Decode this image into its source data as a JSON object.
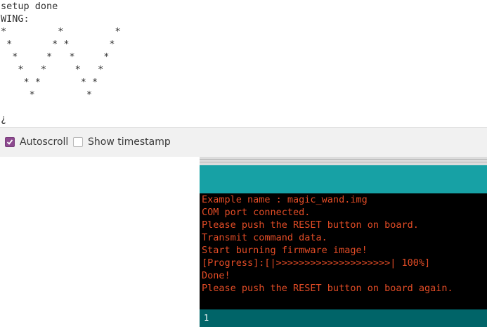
{
  "serial_monitor": {
    "lines": [
      "setup done",
      "WING:",
      "*         *         *",
      " *       * *       *",
      "  *     *   *     *",
      "   *   *     *   *",
      "    * *       * *",
      "     *         *",
      "",
      "¿"
    ],
    "autoscroll_label": "Autoscroll",
    "autoscroll_checked": true,
    "timestamp_label": "Show timestamp",
    "timestamp_checked": false
  },
  "ide_console": {
    "text_color": "#e34c26",
    "accent_color": "#17a1a5",
    "status_color": "#006468",
    "lines": [
      "Example name : magic_wand.img",
      "COM port connected.",
      "Please push the RESET button on board.",
      "Transmit command data.",
      "Start burning firmware image!",
      "[Progress]:[|>>>>>>>>>>>>>>>>>>>>| 100%]",
      "Done!",
      "Please push the RESET button on board again."
    ],
    "status_line_number": "1"
  }
}
